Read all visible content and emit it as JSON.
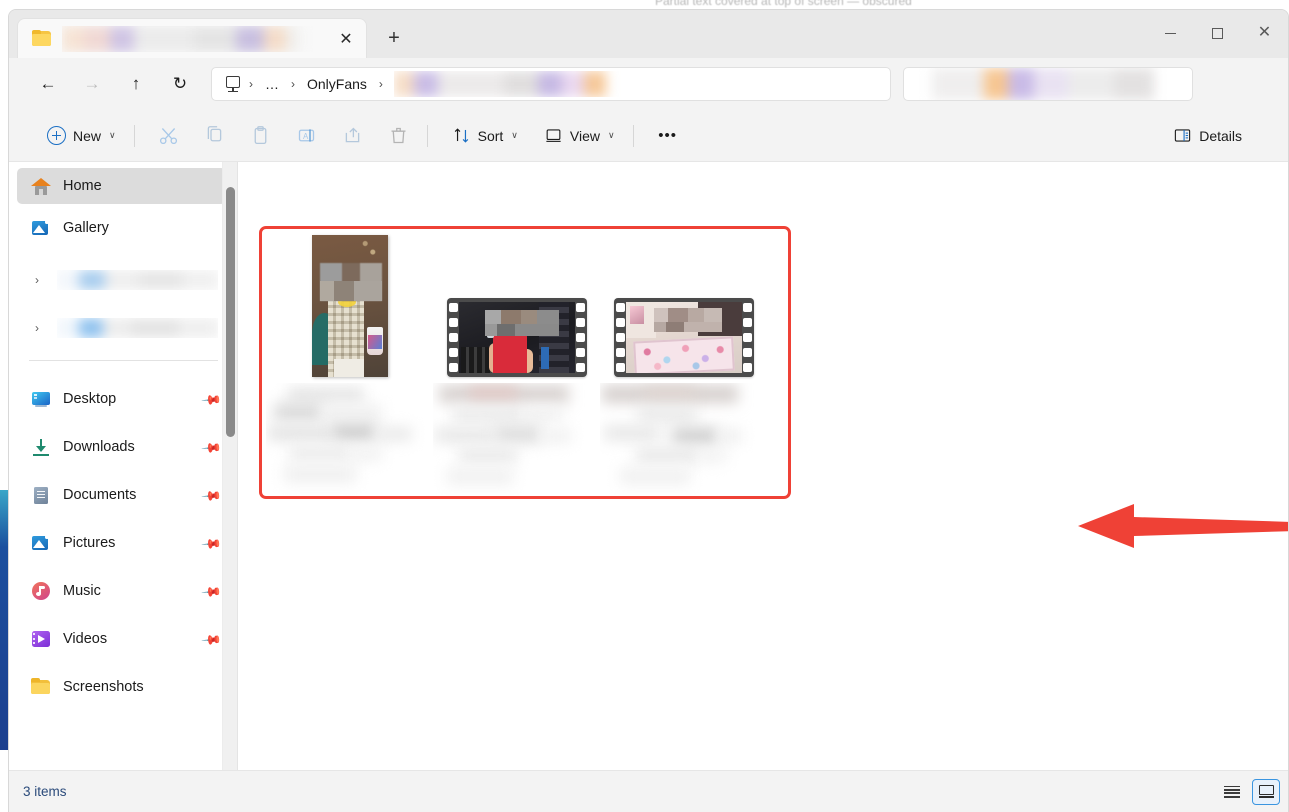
{
  "window": {
    "background_text": "Partial text covered at top of screen — obscured",
    "controls": {
      "minimize_label": "—",
      "maximize_label": "□",
      "close_label": "✕"
    }
  },
  "tabs": {
    "items": [
      {
        "icon": "folder-icon",
        "title_blurred": true,
        "title": "",
        "close_label": "✕"
      }
    ],
    "new_tab_label": "+"
  },
  "navigation": {
    "back_label": "←",
    "forward_label": "→",
    "up_label": "↑",
    "refresh_label": "↻"
  },
  "address_bar": {
    "root_icon": "this-pc-icon",
    "separator": "›",
    "crumbs": [
      {
        "label": "…",
        "blurred": false
      },
      {
        "label": "OnlyFans",
        "blurred": false
      },
      {
        "label": "",
        "blurred": true
      }
    ]
  },
  "search": {
    "placeholder": "",
    "value": "",
    "blurred": true
  },
  "toolbar": {
    "new_label": "New",
    "new_chevron": "∨",
    "cut_label": "Cut",
    "copy_label": "Copy",
    "paste_label": "Paste",
    "rename_label": "Rename",
    "share_label": "Share",
    "delete_label": "Delete",
    "sort_label": "Sort",
    "sort_chevron": "∨",
    "view_label": "View",
    "view_chevron": "∨",
    "more_label": "•••",
    "details_label": "Details"
  },
  "sidebar": {
    "items": [
      {
        "label": "Home",
        "icon": "home-icon",
        "selected": true,
        "pinned": false,
        "expandable": false,
        "blurred": false
      },
      {
        "label": "Gallery",
        "icon": "gallery-icon",
        "selected": false,
        "pinned": false,
        "expandable": false,
        "blurred": false
      },
      {
        "label": "",
        "icon": "cloud-icon",
        "selected": false,
        "pinned": false,
        "expandable": true,
        "blurred": true
      },
      {
        "label": "",
        "icon": "cloud-icon",
        "selected": false,
        "pinned": false,
        "expandable": true,
        "blurred": true
      },
      {
        "label": "Desktop",
        "icon": "desktop-icon",
        "selected": false,
        "pinned": true,
        "expandable": false,
        "blurred": false
      },
      {
        "label": "Downloads",
        "icon": "downloads-icon",
        "selected": false,
        "pinned": true,
        "expandable": false,
        "blurred": false
      },
      {
        "label": "Documents",
        "icon": "documents-icon",
        "selected": false,
        "pinned": true,
        "expandable": false,
        "blurred": false
      },
      {
        "label": "Pictures",
        "icon": "pictures-icon",
        "selected": false,
        "pinned": true,
        "expandable": false,
        "blurred": false
      },
      {
        "label": "Music",
        "icon": "music-icon",
        "selected": false,
        "pinned": true,
        "expandable": false,
        "blurred": false
      },
      {
        "label": "Videos",
        "icon": "videos-icon",
        "selected": false,
        "pinned": true,
        "expandable": false,
        "blurred": false
      },
      {
        "label": "Screenshots",
        "icon": "folder-icon",
        "selected": false,
        "pinned": false,
        "expandable": false,
        "blurred": false
      }
    ],
    "pin_glyph": "📌",
    "expand_glyph": "›"
  },
  "files": {
    "items": [
      {
        "type": "image",
        "name_blurred": true,
        "name": ""
      },
      {
        "type": "video",
        "name_blurred": true,
        "name": ""
      },
      {
        "type": "video",
        "name_blurred": true,
        "name": ""
      }
    ]
  },
  "annotation": {
    "arrow_color": "#ef4136",
    "arrow_direction": "left",
    "highlight_color": "#ef4136"
  },
  "status": {
    "item_count": "3 items",
    "list_view_label": "List view",
    "details_view_label": "Details view",
    "active_view": "details"
  },
  "colors": {
    "accent": "#0067c0",
    "annotation_red": "#ef4136",
    "titlebar": "#e9e9e9",
    "chrome": "#f3f3f3",
    "content": "#ffffff",
    "selected_nav": "#dcdcdc"
  }
}
